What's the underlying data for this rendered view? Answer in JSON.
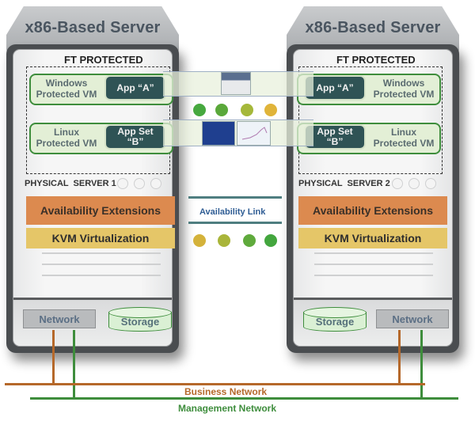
{
  "colors": {
    "business_network": "#b5682a",
    "management_network": "#3e8d3c",
    "availability_extensions": "#dc8a4f",
    "kvm_virtualization": "#e5c668",
    "app_box": "#2f5355",
    "vm_box_border": "#3e8d3c",
    "availability_link": "#4f7e80"
  },
  "servers": [
    {
      "title": "x86-Based Server",
      "ft_label": "FT PROTECTED",
      "vms": [
        {
          "label_line1": "Windows",
          "label_line2": "Protected VM",
          "app_line1": "App “A”",
          "app_line2": ""
        },
        {
          "label_line1": "Linux",
          "label_line2": "Protected VM",
          "app_line1": "App Set",
          "app_line2": "“B”"
        }
      ],
      "physical_label": "PHYSICAL  SERVER 1",
      "availability_label": "Availability Extensions",
      "kvm_label": "KVM Virtualization",
      "network_label": "Network",
      "storage_label": "Storage"
    },
    {
      "title": "x86-Based Server",
      "ft_label": "FT PROTECTED",
      "vms": [
        {
          "label_line1": "Windows",
          "label_line2": "Protected VM",
          "app_line1": "App “A”",
          "app_line2": ""
        },
        {
          "label_line1": "Linux",
          "label_line2": "Protected VM",
          "app_line1": "App Set",
          "app_line2": "“B”"
        }
      ],
      "physical_label": "PHYSICAL  SERVER 2",
      "availability_label": "Availability Extensions",
      "kvm_label": "KVM Virtualization",
      "network_label": "Network",
      "storage_label": "Storage"
    }
  ],
  "sync_dots_top": [
    "#46a83e",
    "#5aa83a",
    "#a5b83a",
    "#e0b43a"
  ],
  "sync_dots_bottom": [
    "#d4b23a",
    "#a9b53a",
    "#5faa3c",
    "#43a63e"
  ],
  "availability_link_label": "Availability Link",
  "business_network_label": "Business Network",
  "management_network_label": "Management Network"
}
